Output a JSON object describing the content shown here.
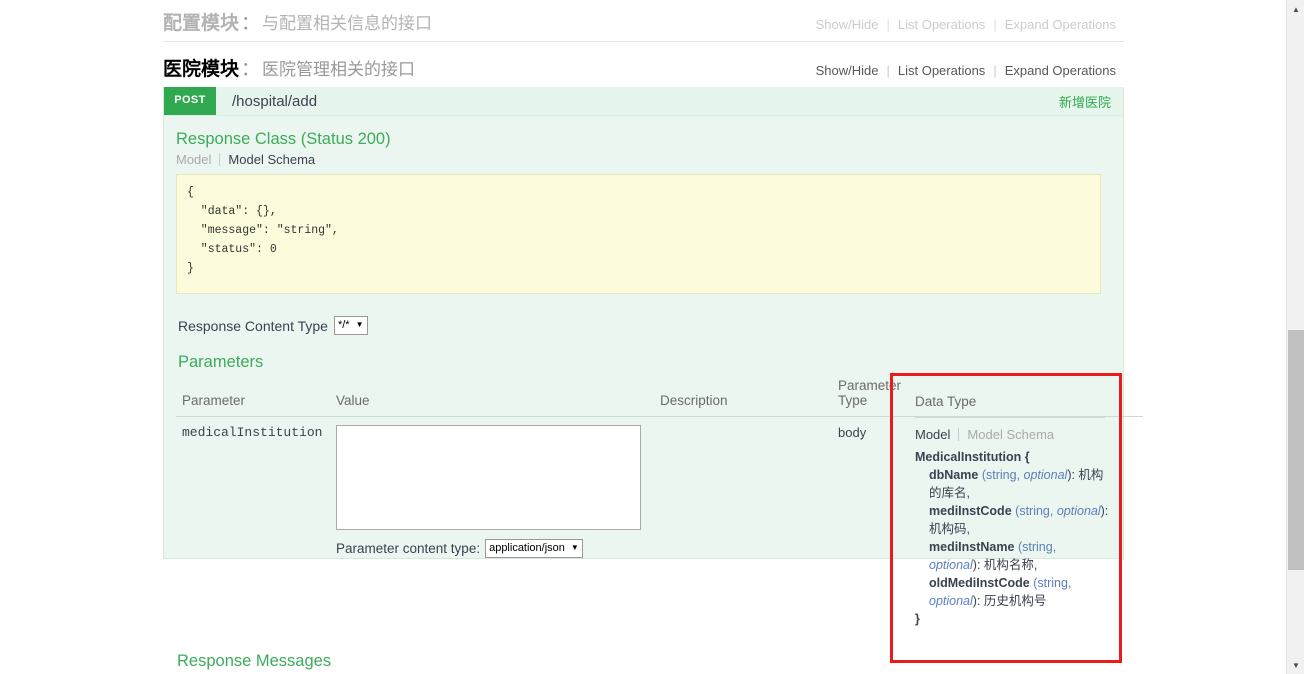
{
  "resources": [
    {
      "name": "配置模块",
      "colon": "：",
      "description": "与配置相关信息的接口",
      "show_hide": "Show/Hide",
      "list_operations": "List Operations",
      "expand_operations": "Expand Operations",
      "active": false
    },
    {
      "name": "医院模块",
      "colon": "：",
      "description": "医院管理相关的接口",
      "show_hide": "Show/Hide",
      "list_operations": "List Operations",
      "expand_operations": "Expand Operations",
      "active": true
    }
  ],
  "operation": {
    "method": "POST",
    "path": "/hospital/add",
    "summary": "新增医院",
    "response_class_title": "Response Class (Status 200)",
    "model_tab": "Model",
    "model_schema_tab": "Model Schema",
    "schema_json": "{\n  \"data\": {},\n  \"message\": \"string\",\n  \"status\": 0\n}",
    "response_content_type_label": "Response Content Type",
    "response_content_type_value": "*/*",
    "parameters_title": "Parameters",
    "response_messages_title": "Response Messages"
  },
  "parameters_table": {
    "headers": {
      "parameter": "Parameter",
      "value": "Value",
      "description": "Description",
      "parameter_type_line1": "Parameter",
      "parameter_type_line2": "Type",
      "data_type": "Data Type"
    },
    "rows": [
      {
        "parameter": "medicalInstitution",
        "value": "",
        "value_placeholder": "",
        "description": "",
        "parameter_type": "body",
        "param_content_type_label": "Parameter content type:",
        "param_content_type_value": "application/json"
      }
    ]
  },
  "data_type_panel": {
    "model_tab": "Model",
    "model_schema_tab": "Model Schema",
    "model_name": "MedicalInstitution {",
    "close_brace": "}",
    "properties": [
      {
        "name": "dbName",
        "type": "string",
        "comma": ", ",
        "optional": "optional",
        "desc": "): 机构的库名,"
      },
      {
        "name": "mediInstCode",
        "type": "string",
        "comma": ", ",
        "optional": "optional",
        "desc": "): 机构码,"
      },
      {
        "name": "mediInstName",
        "type": "string",
        "comma": ", ",
        "optional": "optional",
        "desc": "): 机构名称,"
      },
      {
        "name": "oldMediInstCode",
        "type": "string",
        "comma": ", ",
        "optional": "optional",
        "desc": "): 历史机构号"
      }
    ]
  },
  "colors": {
    "method_post": "#2fa84f",
    "accent_green": "#3cab5a",
    "highlight_red": "#e81c1c",
    "operation_bg": "#ecf6f0",
    "code_bg": "#fcfcdd"
  },
  "scrollbar": {
    "up_arrow": "▲",
    "down_arrow": "▼"
  }
}
